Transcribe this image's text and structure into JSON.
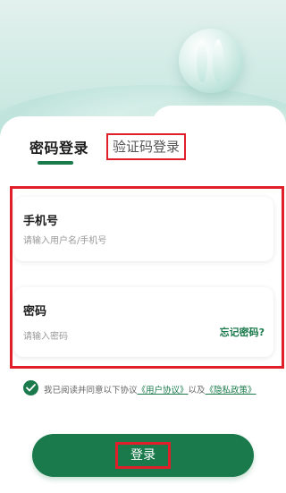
{
  "tabs": {
    "password_login": "密码登录",
    "sms_login": "验证码登录"
  },
  "phone_field": {
    "label": "手机号",
    "placeholder": "请输入用户名/手机号"
  },
  "password_field": {
    "label": "密码",
    "placeholder": "请输入密码",
    "forgot": "忘记密码?"
  },
  "agreement": {
    "prefix": "我已阅读并同意以下协议",
    "user_agreement": "《用户协议》",
    "conjunction": "以及",
    "privacy_policy": "《隐私政策》",
    "checked": true
  },
  "login_button": "登录",
  "icons": {
    "hero": "glass-orb-icon",
    "check": "check-icon"
  },
  "colors": {
    "primary": "#1a7a4c",
    "highlight": "#e01f2a"
  }
}
